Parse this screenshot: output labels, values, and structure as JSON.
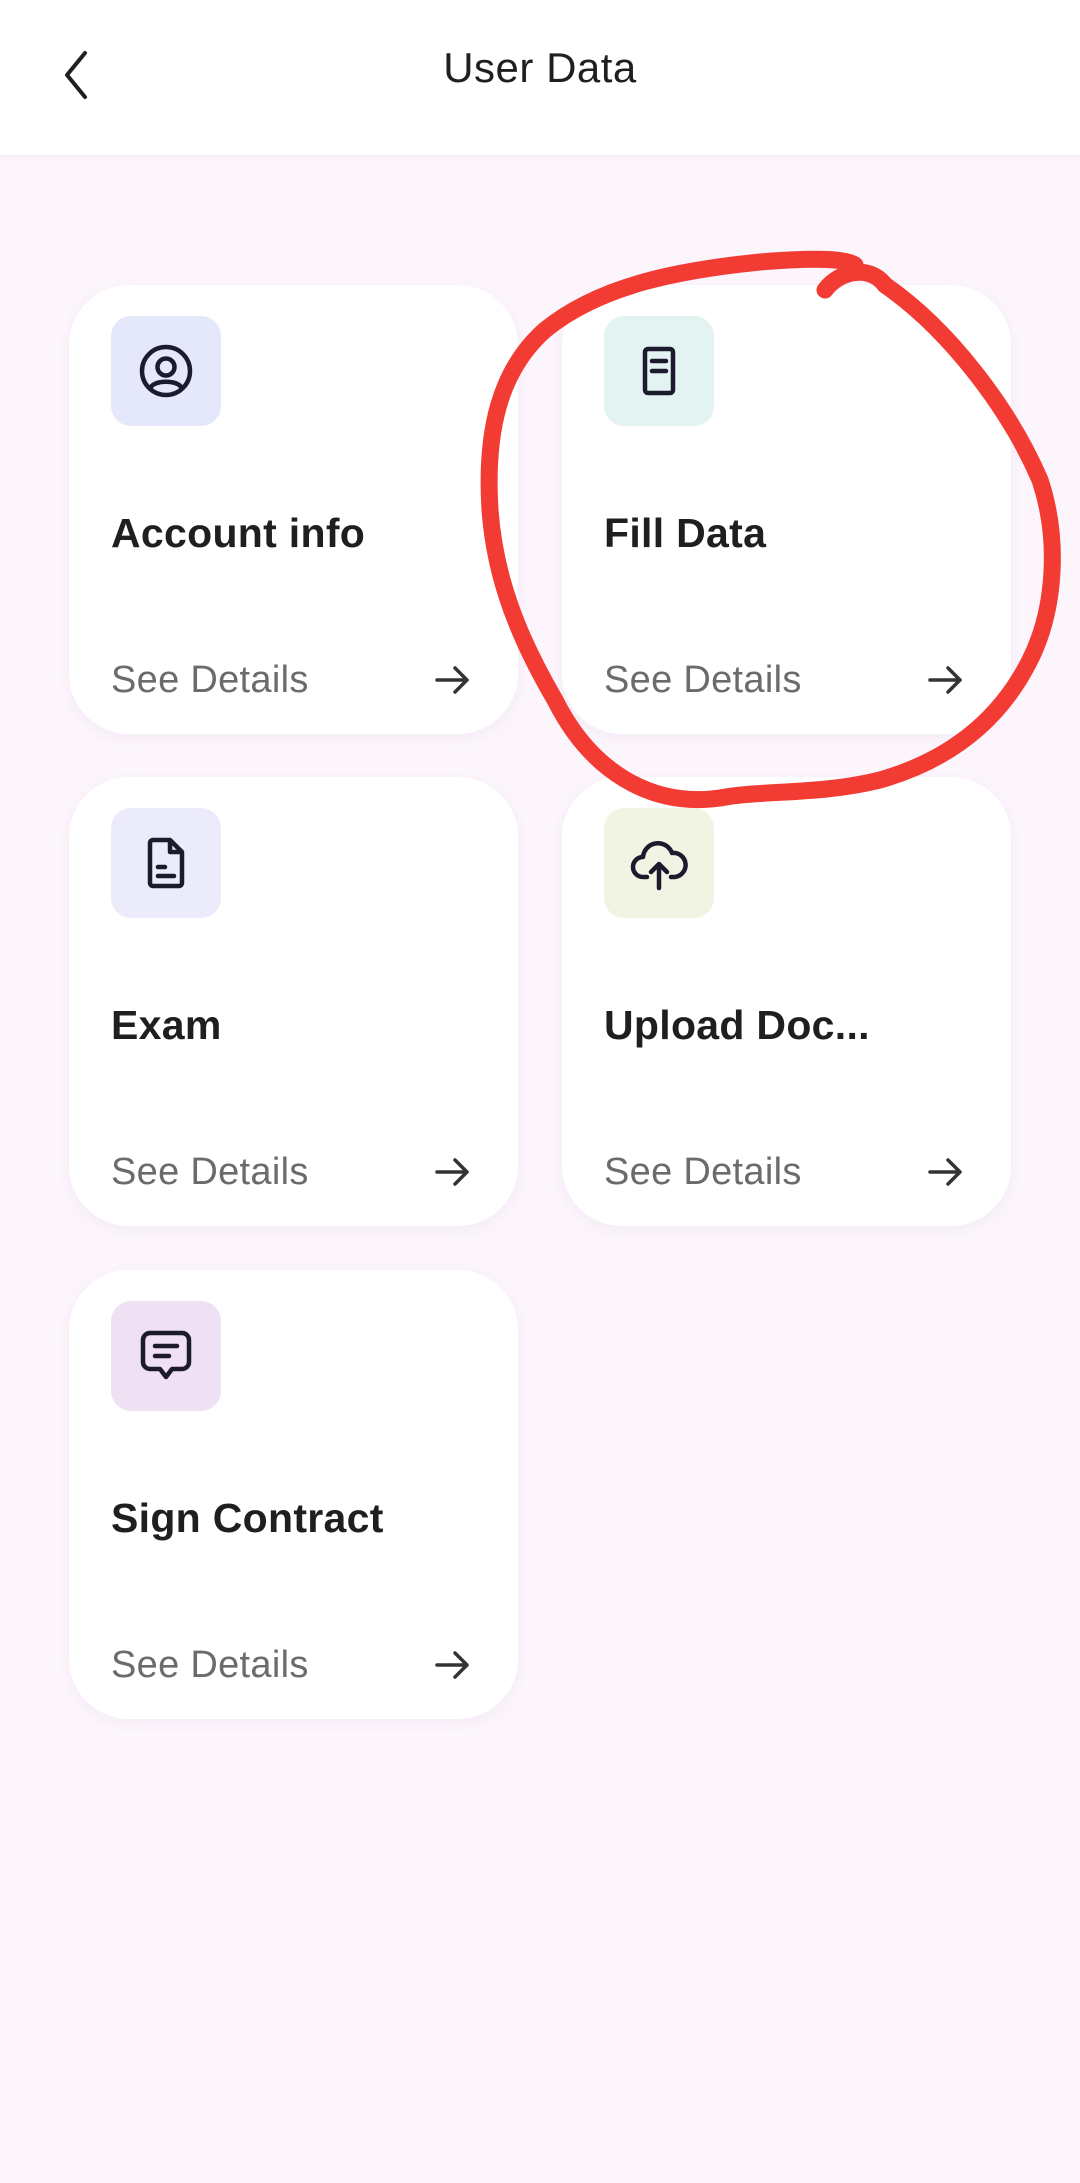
{
  "header": {
    "title": "User Data",
    "back_icon": "chevron-left-icon"
  },
  "cards": [
    {
      "title": "Account info",
      "link": "See Details",
      "icon": "user-circle-icon",
      "icon_bg": "#e5e8fb"
    },
    {
      "title": "Fill Data",
      "link": "See Details",
      "icon": "document-icon",
      "icon_bg": "#e2f3f1"
    },
    {
      "title": "Exam",
      "link": "See Details",
      "icon": "file-text-icon",
      "icon_bg": "#ebebfb"
    },
    {
      "title": "Upload Doc...",
      "link": "See Details",
      "icon": "cloud-upload-icon",
      "icon_bg": "#f1f4e3"
    },
    {
      "title": "Sign Contract",
      "link": "See Details",
      "icon": "message-icon",
      "icon_bg": "#efe0f3"
    }
  ],
  "colors": {
    "background": "#fcf5fc",
    "card": "#ffffff",
    "annotation": "#f23b33"
  }
}
